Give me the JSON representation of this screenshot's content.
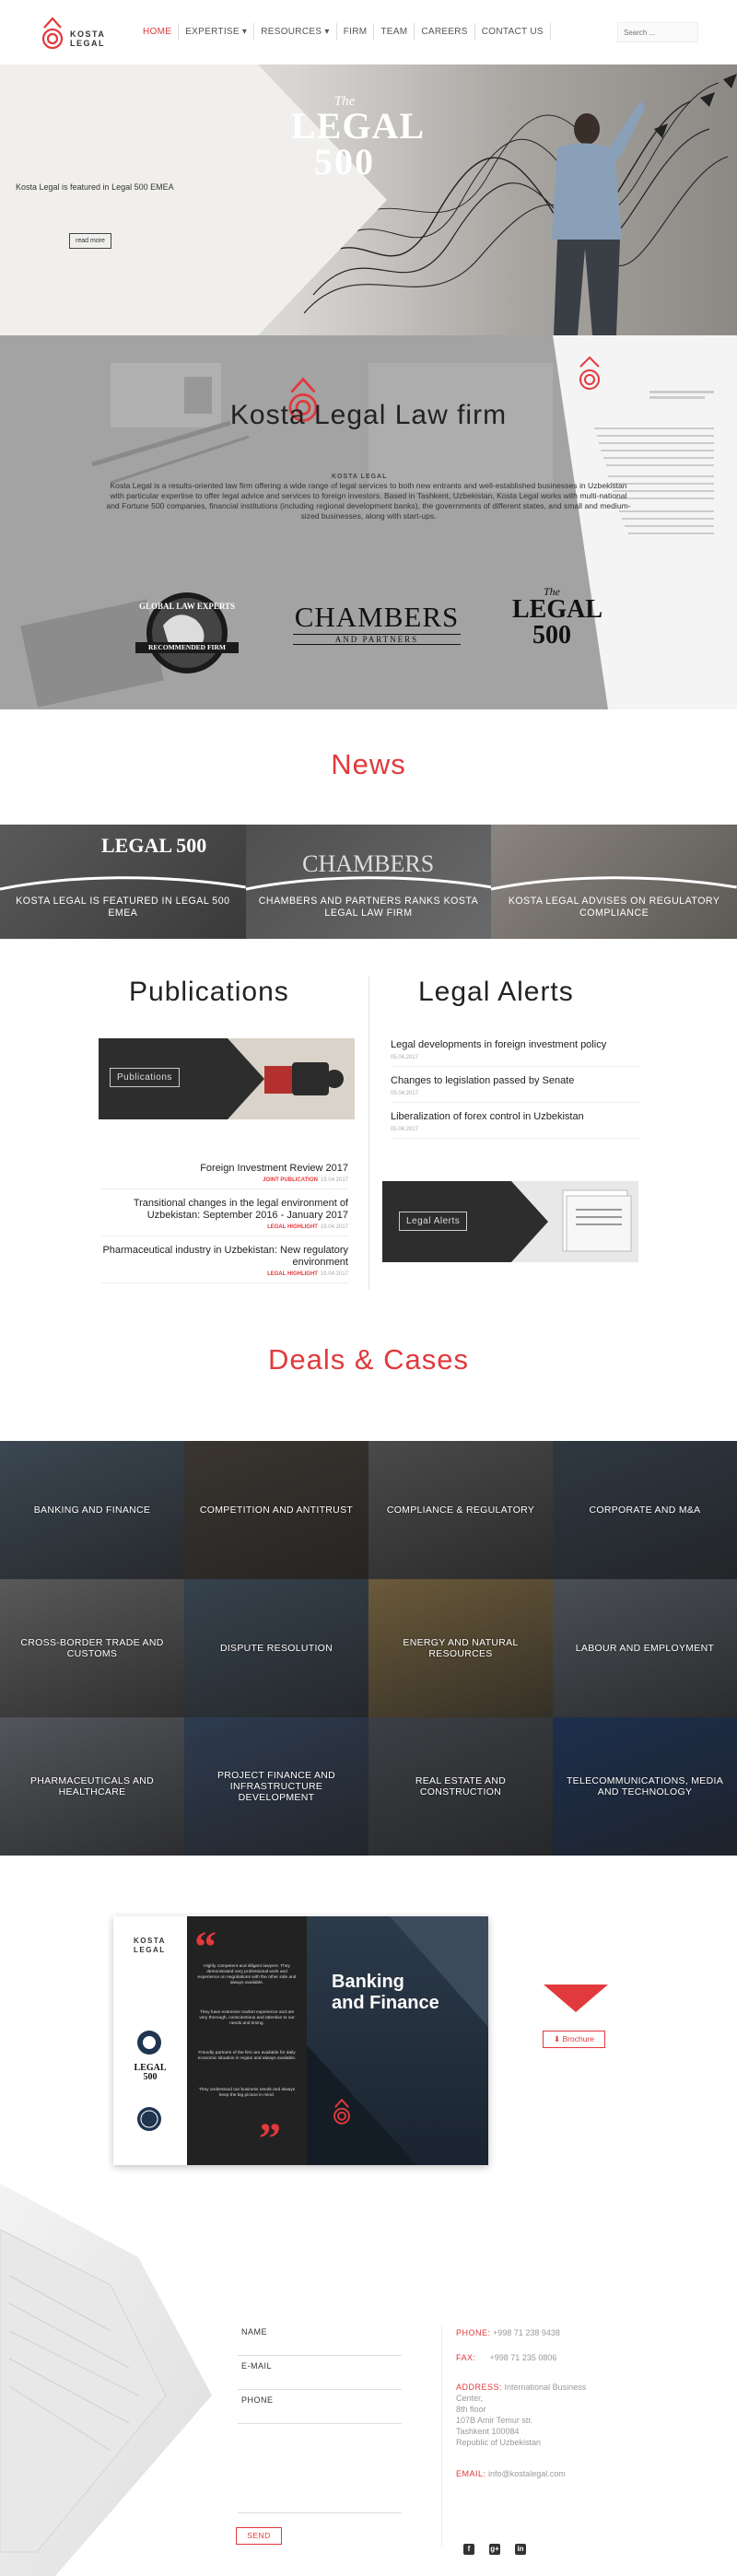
{
  "header": {
    "logo_line1": "KOSTA",
    "logo_line2": "LEGAL",
    "nav": [
      {
        "label": "HOME"
      },
      {
        "label": "EXPERTISE ▾"
      },
      {
        "label": "RESOURCES ▾"
      },
      {
        "label": "FIRM"
      },
      {
        "label": "TEAM"
      },
      {
        "label": "CAREERS"
      },
      {
        "label": "CONTACT US"
      }
    ],
    "search_placeholder": "Search ..."
  },
  "hero": {
    "caption": "Kosta Legal is featured in Legal 500 EMEA",
    "button": "read more",
    "logo_the": "The",
    "logo_legal": "LEGAL",
    "logo_500": "500"
  },
  "about": {
    "title": "Kosta Legal Law firm",
    "description": "Kosta Legal is a results-oriented law firm offering a wide range of legal services to both new entrants and well-established businesses in Uzbekistan with particular expertise to offer legal advice and services to foreign investors. Based in Tashkent, Uzbekistan, Kosta Legal works with multi-national and Fortune 500 companies, financial institutions (including regional development banks), the governments of different states, and small and medium-sized businesses, along with start-ups.",
    "award_glte_top": "GLOBAL LAW EXPERTS",
    "award_glte_bottom": "RECOMMENDED FIRM",
    "award_chambers": "CHAMBERS",
    "award_chambers_sub": "AND PARTNERS",
    "award_l500_the": "The",
    "award_l500_legal": "LEGAL",
    "award_l500_num": "500",
    "watermark": "KOSTA LEGAL"
  },
  "news": {
    "title": "News",
    "items": [
      {
        "caption": "KOSTA LEGAL IS FEATURED IN LEGAL 500 EMEA",
        "logo": "LEGAL 500"
      },
      {
        "caption": "CHAMBERS AND PARTNERS RANKS KOSTA LEGAL LAW FIRM",
        "logo": "CHAMBERS"
      },
      {
        "caption": "KOSTA LEGAL ADVISES ON REGULATORY COMPLIANCE",
        "logo": ""
      }
    ]
  },
  "publications": {
    "title": "Publications",
    "banner_label": "Publications",
    "items": [
      {
        "title": "Foreign Investment Review 2017",
        "tag": "JOINT PUBLICATION",
        "date": "19.04.2017"
      },
      {
        "title": "Transitional changes in the legal environment of Uzbekistan: September 2016 - January 2017",
        "tag": "LEGAL HIGHLIGHT",
        "date": "19.04.2017"
      },
      {
        "title": "Pharmaceutical industry in Uzbekistan: New regulatory environment",
        "tag": "LEGAL HIGHLIGHT",
        "date": "19.04.2017"
      }
    ]
  },
  "alerts": {
    "title": "Legal Alerts",
    "banner_label": "Legal Alerts",
    "items": [
      {
        "title": "Legal developments in foreign investment policy",
        "date": "05.04.2017"
      },
      {
        "title": "Changes to legislation passed by Senate",
        "date": "05.04.2017"
      },
      {
        "title": "Liberalization of forex control in Uzbekistan",
        "date": "05.04.2017"
      }
    ]
  },
  "deals": {
    "title": "Deals & Cases",
    "items": [
      {
        "label": "BANKING AND FINANCE",
        "bg": "#3b4752"
      },
      {
        "label": "COMPETITION AND ANTITRUST",
        "bg": "#3a3530"
      },
      {
        "label": "COMPLIANCE & REGULATORY",
        "bg": "#4a4a4a"
      },
      {
        "label": "CORPORATE AND M&A",
        "bg": "#2f3842"
      },
      {
        "label": "CROSS-BORDER TRADE AND CUSTOMS",
        "bg": "#595959"
      },
      {
        "label": "DISPUTE RESOLUTION",
        "bg": "#36424d"
      },
      {
        "label": "ENERGY AND NATURAL RESOURCES",
        "bg": "#6b5a3a"
      },
      {
        "label": "LABOUR AND EMPLOYMENT",
        "bg": "#4a4f55"
      },
      {
        "label": "PHARMACEUTICALS AND HEALTHCARE",
        "bg": "#52555a"
      },
      {
        "label": "PROJECT FINANCE AND INFRASTRUCTURE DEVELOPMENT",
        "bg": "#2e3b4f"
      },
      {
        "label": "REAL ESTATE AND CONSTRUCTION",
        "bg": "#3c3f44"
      },
      {
        "label": "TELECOMMUNICATIONS, MEDIA AND TECHNOLOGY",
        "bg": "#1d2f4d"
      }
    ]
  },
  "brochure": {
    "brand1": "KOSTA",
    "brand2": "LEGAL",
    "title_line1": "Banking",
    "title_line2": "and Finance",
    "quote1": "Highly competent and diligent lawyers. They demonstrated very professional work and experience on negotiations with the other side and always available.",
    "quote2": "They have extensive market experience and are very thorough, conscientious and attentive to our needs and timing.",
    "quote3": "Friendly partners of the firm are available for daily economic situation in region and always available.",
    "quote4": "They understood our business needs and always keep the big picture in mind.",
    "button": "Brochure"
  },
  "contact_form": {
    "name_label": "NAME",
    "email_label": "E-MAIL",
    "phone_label": "PHONE",
    "send": "SEND"
  },
  "contact": {
    "phone_label": "PHONE:",
    "phone": "+998 71 238 9438",
    "fax_label": "FAX:",
    "fax": "+998 71 235 0806",
    "address_label": "ADDRESS:",
    "address1": "International Business",
    "address2": "Center,",
    "address3": "8th floor",
    "address4": "107B Amir Temur str.",
    "address5": "Tashkent 100084",
    "address6": "Republic of Uzbekistan",
    "email_label": "EMAIL:",
    "email": "info@kostalegal.com",
    "social": [
      "f",
      "g+",
      "in"
    ]
  },
  "colors": {
    "accent": "#e2393c"
  }
}
